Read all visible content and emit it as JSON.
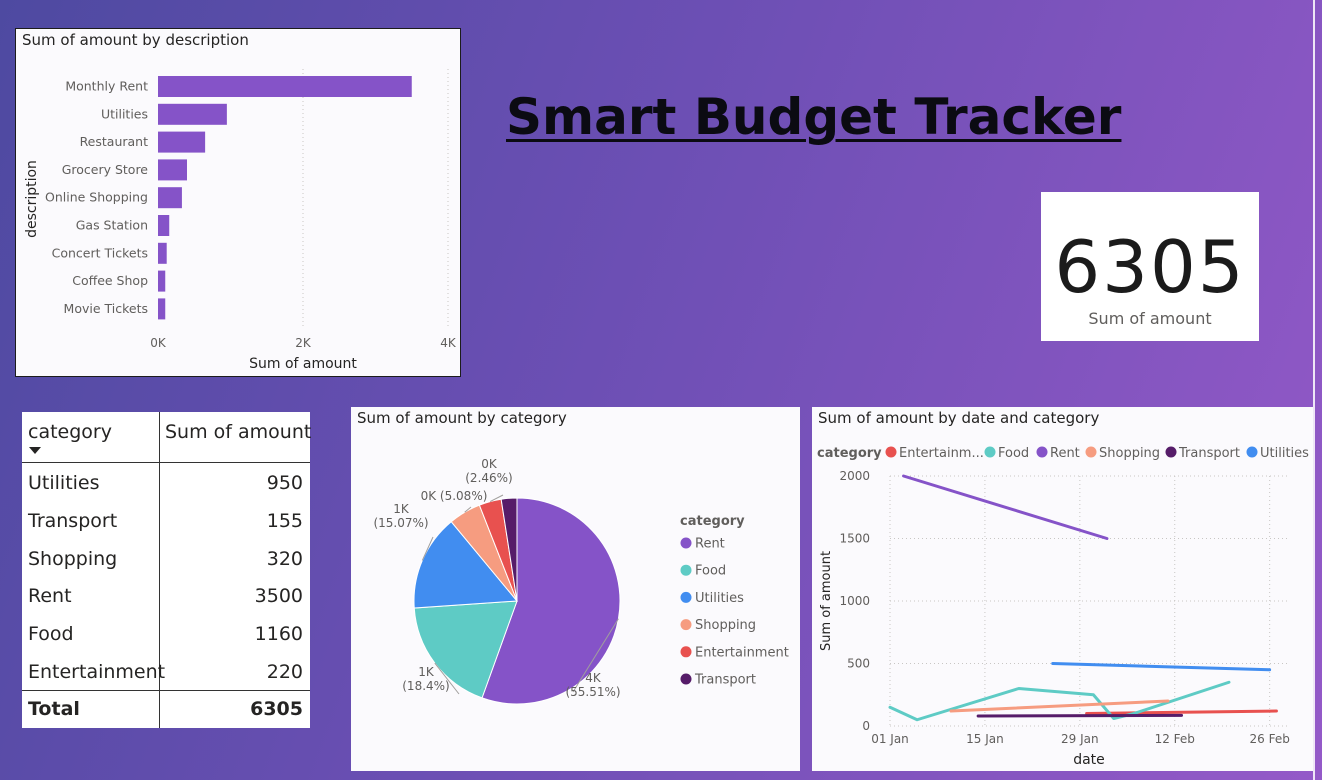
{
  "header": {
    "title": "Smart Budget Tracker"
  },
  "kpi": {
    "value": "6305",
    "label": "Sum of amount"
  },
  "table": {
    "headers": [
      "category",
      "Sum of amount"
    ],
    "rows": [
      {
        "category": "Utilities",
        "amount": "950"
      },
      {
        "category": "Transport",
        "amount": "155"
      },
      {
        "category": "Shopping",
        "amount": "320"
      },
      {
        "category": "Rent",
        "amount": "3500"
      },
      {
        "category": "Food",
        "amount": "1160"
      },
      {
        "category": "Entertainment",
        "amount": "220"
      }
    ],
    "total_label": "Total",
    "total_value": "6305"
  },
  "colors": {
    "Rent": "#8553c8",
    "Food": "#5ecbc5",
    "Utilities": "#418df0",
    "Shopping": "#f69c80",
    "Entertainment": "#e8514f",
    "Transport": "#561c69"
  },
  "chart_data": [
    {
      "type": "bar",
      "orientation": "horizontal",
      "title": "Sum of amount by description",
      "xlabel": "Sum of amount",
      "ylabel": "description",
      "categories": [
        "Monthly Rent",
        "Utilities",
        "Restaurant",
        "Grocery Store",
        "Online Shopping",
        "Gas Station",
        "Concert Tickets",
        "Coffee Shop",
        "Movie Tickets"
      ],
      "values": [
        3500,
        950,
        650,
        400,
        330,
        155,
        120,
        100,
        100
      ],
      "xlim": [
        0,
        4000
      ],
      "xticks": [
        "0K",
        "2K",
        "4K"
      ],
      "grid": true,
      "color": "#8553c8"
    },
    {
      "type": "pie",
      "title": "Sum of amount by category",
      "legend_title": "category",
      "legend_position": "right",
      "slices": [
        {
          "name": "Rent",
          "value": 3500,
          "label": "4K",
          "percent": "(55.51%)"
        },
        {
          "name": "Food",
          "value": 1160,
          "label": "1K",
          "percent": "(18.4%)"
        },
        {
          "name": "Utilities",
          "value": 950,
          "label": "1K",
          "percent": "(15.07%)"
        },
        {
          "name": "Shopping",
          "value": 320,
          "label": "0K (5.08%)",
          "percent": ""
        },
        {
          "name": "Entertainment",
          "value": 220,
          "label": "0K",
          "percent": "(2.46%)"
        },
        {
          "name": "Transport",
          "value": 155,
          "label": "",
          "percent": ""
        }
      ]
    },
    {
      "type": "line",
      "title": "Sum of amount by date and category",
      "legend_title": "category",
      "legend_position": "top",
      "xlabel": "date",
      "ylabel": "Sum of amount",
      "ylim": [
        0,
        2000
      ],
      "yticks": [
        "0",
        "500",
        "1000",
        "1500",
        "2000"
      ],
      "xticks": [
        "01 Jan",
        "15 Jan",
        "29 Jan",
        "12 Feb",
        "26 Feb"
      ],
      "legend": [
        "Entertainm...",
        "Food",
        "Rent",
        "Shopping",
        "Transport",
        "Utilities"
      ],
      "series": [
        {
          "name": "Entertainment",
          "points": [
            [
              "2024-01-30",
              100
            ],
            [
              "2024-02-27",
              120
            ]
          ]
        },
        {
          "name": "Food",
          "points": [
            [
              "2024-01-01",
              150
            ],
            [
              "2024-01-05",
              50
            ],
            [
              "2024-01-20",
              300
            ],
            [
              "2024-01-31",
              250
            ],
            [
              "2024-02-03",
              60
            ],
            [
              "2024-02-06",
              100
            ],
            [
              "2024-02-20",
              350
            ]
          ]
        },
        {
          "name": "Rent",
          "points": [
            [
              "2024-01-03",
              2000
            ],
            [
              "2024-02-02",
              1500
            ]
          ]
        },
        {
          "name": "Shopping",
          "points": [
            [
              "2024-01-10",
              120
            ],
            [
              "2024-02-11",
              200
            ]
          ]
        },
        {
          "name": "Transport",
          "points": [
            [
              "2024-01-14",
              80
            ],
            [
              "2024-02-13",
              85
            ]
          ]
        },
        {
          "name": "Utilities",
          "points": [
            [
              "2024-01-25",
              500
            ],
            [
              "2024-02-26",
              450
            ]
          ]
        }
      ]
    }
  ]
}
